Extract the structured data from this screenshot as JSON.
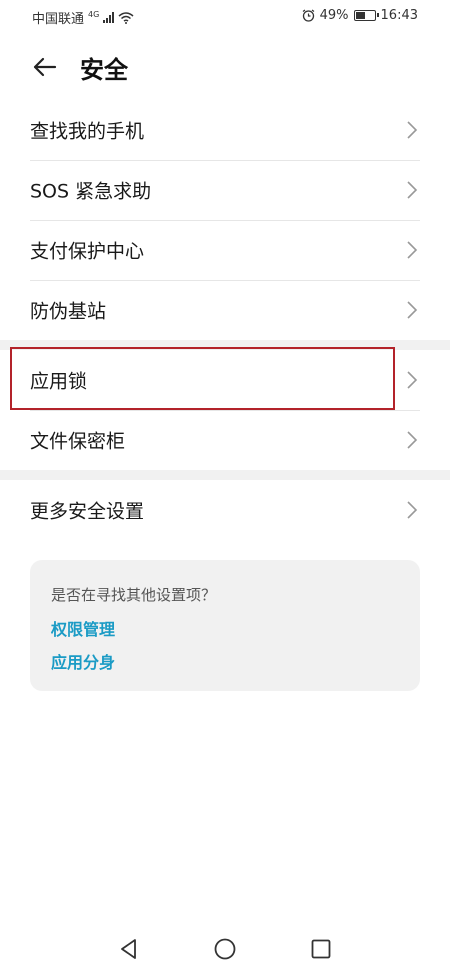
{
  "status_bar": {
    "carrier": "中国联通",
    "network": "4G",
    "battery": "49%",
    "time": "16:43"
  },
  "header": {
    "title": "安全"
  },
  "group1": [
    {
      "label": "查找我的手机"
    },
    {
      "label": "SOS 紧急求助"
    },
    {
      "label": "支付保护中心"
    },
    {
      "label": "防伪基站"
    }
  ],
  "group2": [
    {
      "label": "应用锁"
    },
    {
      "label": "文件保密柜"
    }
  ],
  "group3": [
    {
      "label": "更多安全设置"
    }
  ],
  "suggestions": {
    "question": "是否在寻找其他设置项？",
    "links": [
      "权限管理",
      "应用分身"
    ]
  },
  "colors": {
    "link": "#1b9bc5",
    "highlight": "#b3232a"
  }
}
